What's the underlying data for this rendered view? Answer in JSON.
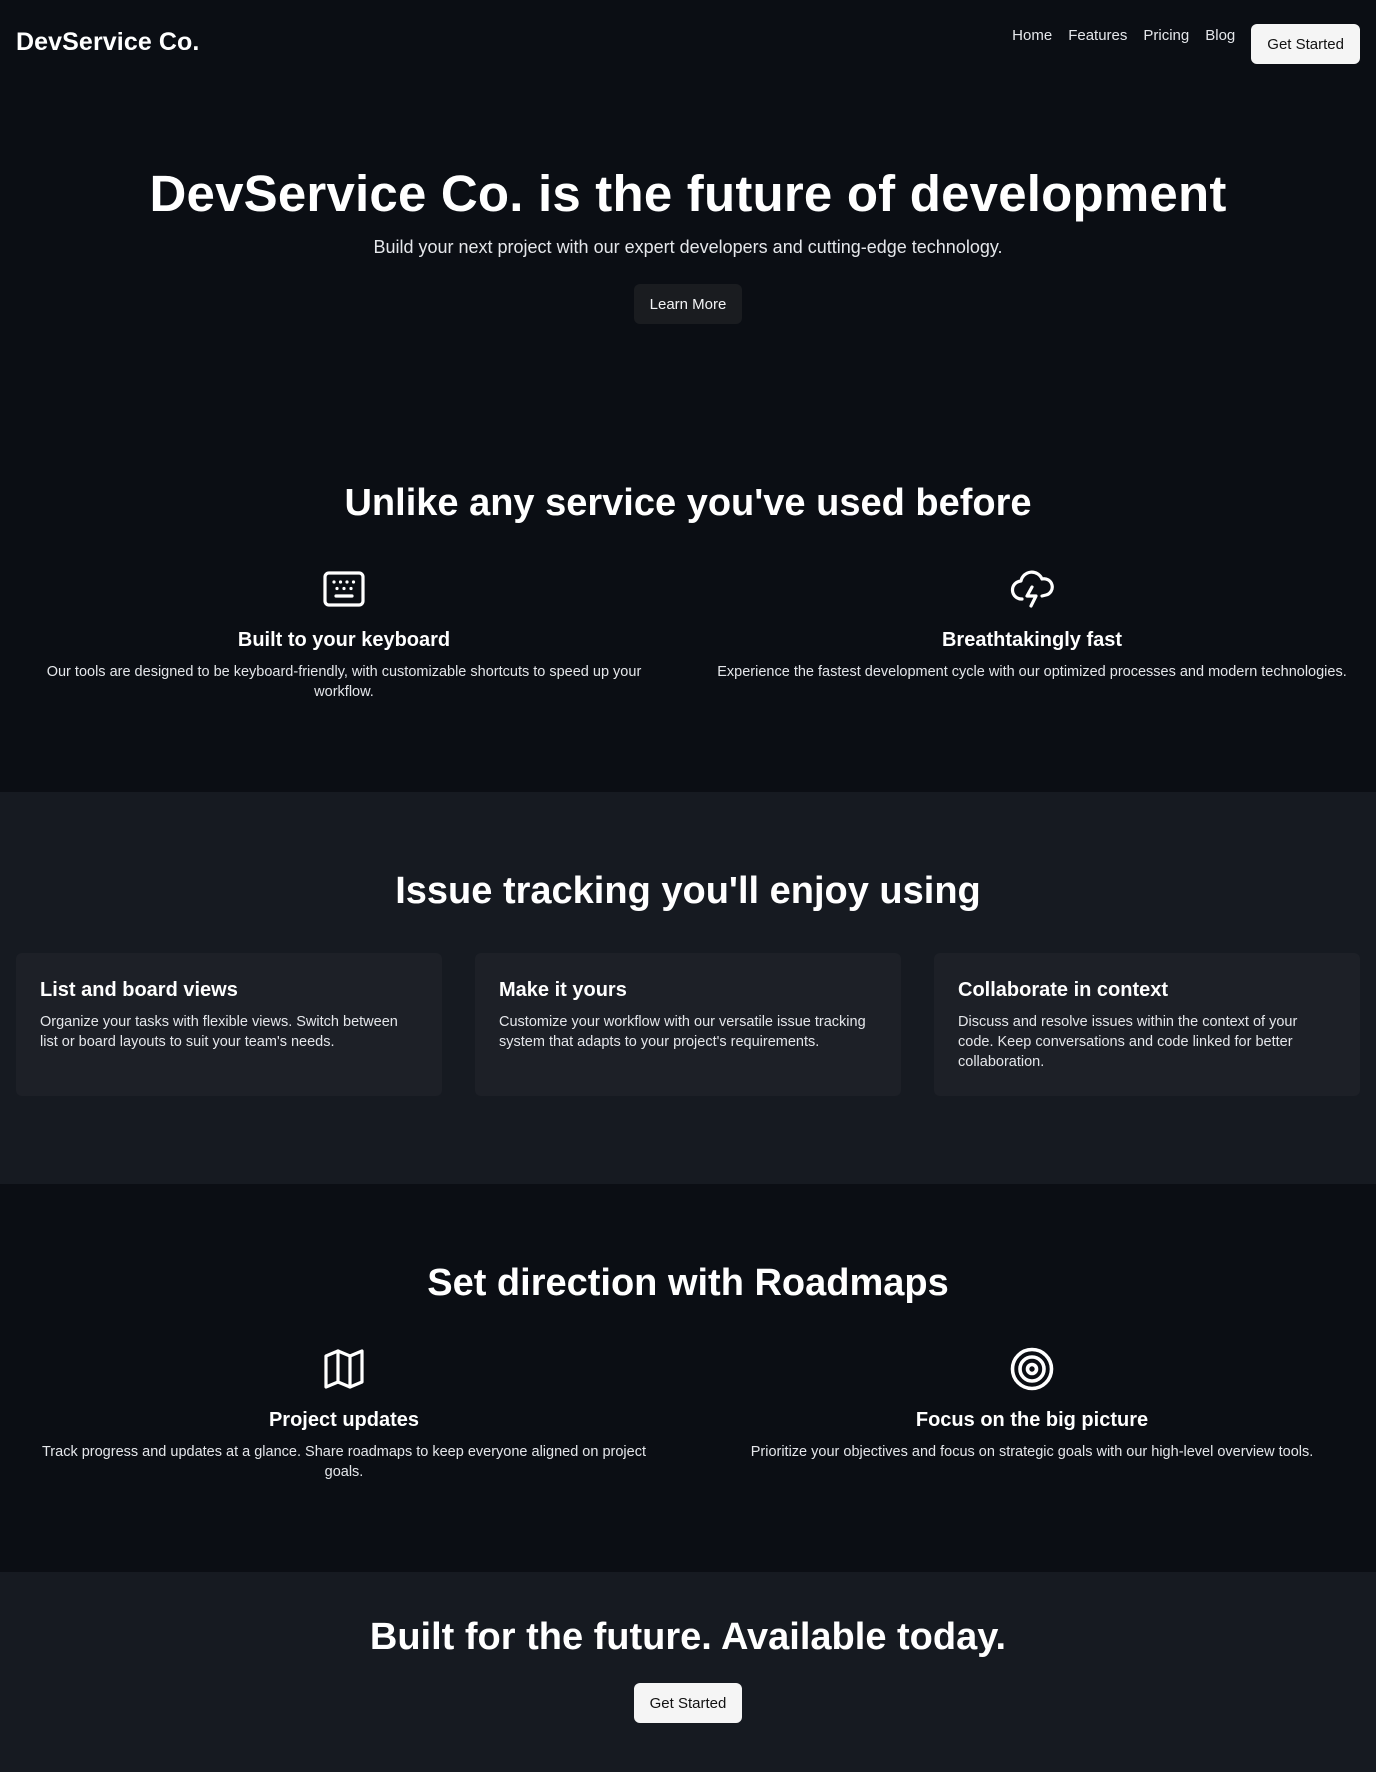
{
  "header": {
    "logo": "DevService Co.",
    "nav": [
      "Home",
      "Features",
      "Pricing",
      "Blog"
    ],
    "cta_label": "Get Started"
  },
  "hero": {
    "title": "DevService Co. is the future of development",
    "subtitle": "Build your next project with our expert developers and cutting-edge technology.",
    "button_label": "Learn More"
  },
  "features": {
    "title": "Unlike any service you've used before",
    "items": [
      {
        "icon": "keyboard-icon",
        "title": "Built to your keyboard",
        "description": "Our tools are designed to be keyboard-friendly, with customizable shortcuts to speed up your workflow."
      },
      {
        "icon": "cloud-lightning-icon",
        "title": "Breathtakingly fast",
        "description": "Experience the fastest development cycle with our optimized processes and modern technologies."
      }
    ]
  },
  "issues": {
    "title": "Issue tracking you'll enjoy using",
    "cards": [
      {
        "title": "List and board views",
        "description": "Organize your tasks with flexible views. Switch between list or board layouts to suit your team's needs."
      },
      {
        "title": "Make it yours",
        "description": "Customize your workflow with our versatile issue tracking system that adapts to your project's requirements."
      },
      {
        "title": "Collaborate in context",
        "description": "Discuss and resolve issues within the context of your code. Keep conversations and code linked for better collaboration."
      }
    ]
  },
  "roadmaps": {
    "title": "Set direction with Roadmaps",
    "items": [
      {
        "icon": "map-icon",
        "title": "Project updates",
        "description": "Track progress and updates at a glance. Share roadmaps to keep everyone aligned on project goals."
      },
      {
        "icon": "target-icon",
        "title": "Focus on the big picture",
        "description": "Prioritize your objectives and focus on strategic goals with our high-level overview tools."
      }
    ]
  },
  "cta": {
    "title": "Built for the future. Available today.",
    "button_label": "Get Started"
  },
  "colors": {
    "background": "#0b0e14",
    "section_alt": "#161a21",
    "card": "#1d2027",
    "button_light": "#f5f5f5",
    "button_dark": "#1a1c20"
  }
}
